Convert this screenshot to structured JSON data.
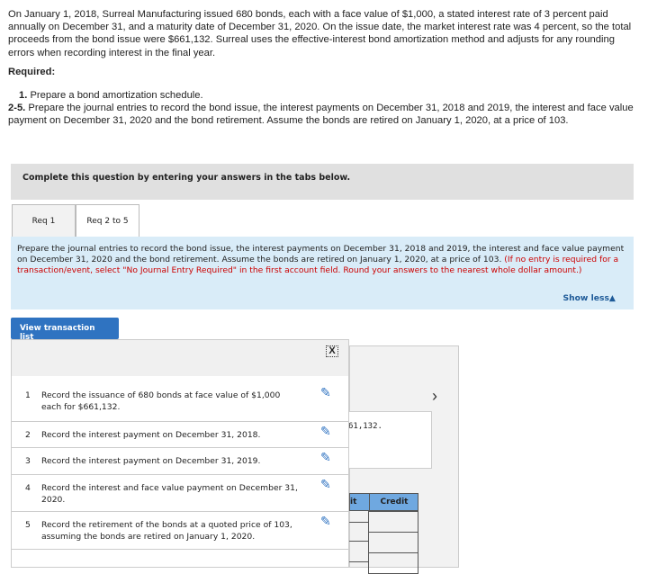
{
  "intro": "On January 1, 2018, Surreal Manufacturing issued 680 bonds, each with a face value of $1,000, a stated interest rate of 3 percent paid annually on December 31, and a maturity date of December 31, 2020. On the issue date, the market interest rate was 4 percent, so the total proceeds from the bond issue were $661,132. Surreal uses the effective-interest bond amortization method and adjusts for any rounding errors when recording interest in the final year.",
  "required_label": "Required:",
  "requirements": [
    {
      "num": "1.",
      "text": "Prepare a bond amortization schedule."
    },
    {
      "num": "2-5.",
      "text": "Prepare the journal entries to record the bond issue, the interest payments on December 31, 2018 and 2019, the interest and face value payment on December 31, 2020 and the bond retirement. Assume the bonds are retired on January 1, 2020, at a price of 103."
    }
  ],
  "instruction_bar": "Complete this question by entering your answers in the tabs below.",
  "tabs": [
    {
      "label": "Req 1"
    },
    {
      "label": "Req 2 to 5"
    }
  ],
  "panel": {
    "text": "Prepare the journal entries to record the bond issue, the interest payments on December 31, 2018 and 2019,  the interest and face value payment on December 31, 2020 and the bond retirement. Assume the bonds are retired on January 1, 2020, at a price of 103. ",
    "note": "(If no entry is required for a transaction/event, select \"No Journal Entry Required\" in the first account field. Round your answers to the nearest whole dollar amount.)",
    "show_less": "Show less▲"
  },
  "view_list_button": "View transaction list",
  "close_symbol": "X",
  "transactions": [
    {
      "num": "1",
      "text": "Record the issuance of 680 bonds at face value of $1,000 each for $661,132."
    },
    {
      "num": "2",
      "text": "Record the interest payment on December 31, 2018."
    },
    {
      "num": "3",
      "text": "Record the interest payment on December 31, 2019."
    },
    {
      "num": "4",
      "text": "Record the interest and face value payment on December 31, 2020."
    },
    {
      "num": "5",
      "text": "Record the retirement of the bonds at a quoted price of 103, assuming the bonds are retired on January 1, 2020."
    }
  ],
  "background": {
    "partial_text": "61,132.",
    "debit_partial": "it",
    "credit": "Credit",
    "next": "›"
  }
}
